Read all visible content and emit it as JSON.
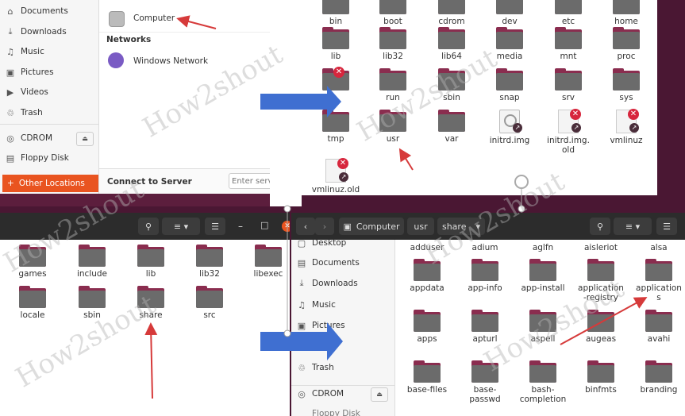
{
  "watermark": "How2shout",
  "tl": {
    "sidebar": [
      {
        "icon": "home-icon",
        "glyph": "⌂",
        "label": "Documents"
      },
      {
        "icon": "download-icon",
        "glyph": "⤓",
        "label": "Downloads"
      },
      {
        "icon": "music-icon",
        "glyph": "♫",
        "label": "Music"
      },
      {
        "icon": "pictures-icon",
        "glyph": "▣",
        "label": "Pictures"
      },
      {
        "icon": "videos-icon",
        "glyph": "▶",
        "label": "Videos"
      },
      {
        "icon": "trash-icon",
        "glyph": "♲",
        "label": "Trash"
      },
      {
        "icon": "cdrom-icon",
        "glyph": "◎",
        "label": "CDROM"
      },
      {
        "icon": "floppy-icon",
        "glyph": "▤",
        "label": "Floppy Disk"
      }
    ],
    "other_locations": "Other Locations",
    "computer": "Computer",
    "networks_header": "Networks",
    "windows_network": "Windows Network",
    "connect_label": "Connect to Server",
    "connect_placeholder": "Enter serv"
  },
  "tr": {
    "row1": [
      "bin",
      "boot",
      "cdrom",
      "dev",
      "etc",
      "home"
    ],
    "row2": [
      "lib",
      "lib32",
      "lib64",
      "media",
      "mnt",
      "proc"
    ],
    "row3": [
      "",
      "run",
      "sbin",
      "snap",
      "srv",
      "sys"
    ],
    "row4": [
      "tmp",
      "usr",
      "var",
      "initrd.img",
      "initrd.img.\nold",
      "vmlinuz"
    ],
    "row5": [
      "vmlinuz.old"
    ]
  },
  "bl": {
    "row1": [
      "games",
      "include",
      "lib",
      "lib32",
      "libexec"
    ],
    "row2": [
      "locale",
      "sbin",
      "share",
      "src"
    ]
  },
  "br": {
    "path": [
      "Computer",
      "usr",
      "share"
    ],
    "sidebar": [
      {
        "icon": "desktop-icon",
        "glyph": "▢",
        "label": "Desktop"
      },
      {
        "icon": "documents-icon",
        "glyph": "▤",
        "label": "Documents"
      },
      {
        "icon": "download-icon",
        "glyph": "⤓",
        "label": "Downloads"
      },
      {
        "icon": "music-icon",
        "glyph": "♫",
        "label": "Music"
      },
      {
        "icon": "pictures-icon",
        "glyph": "▣",
        "label": "Pictures"
      },
      {
        "icon": "videos-icon",
        "glyph": "▶",
        "label": ""
      },
      {
        "icon": "trash-icon",
        "glyph": "♲",
        "label": "Trash"
      },
      {
        "icon": "cdrom-icon",
        "glyph": "◎",
        "label": "CDROM"
      }
    ],
    "floppy": "Floppy Disk",
    "top_labels": [
      "adduser",
      "adium",
      "aglfn",
      "aisleriot",
      "alsa"
    ],
    "row1": [
      "appdata",
      "app-info",
      "app-install",
      "application\n-registry",
      "application\ns"
    ],
    "row2": [
      "apps",
      "apturl",
      "aspell",
      "augeas",
      "avahi"
    ],
    "row3": [
      "base-files",
      "base-\npasswd",
      "bash-\ncompletion",
      "binfmts",
      "branding"
    ]
  }
}
